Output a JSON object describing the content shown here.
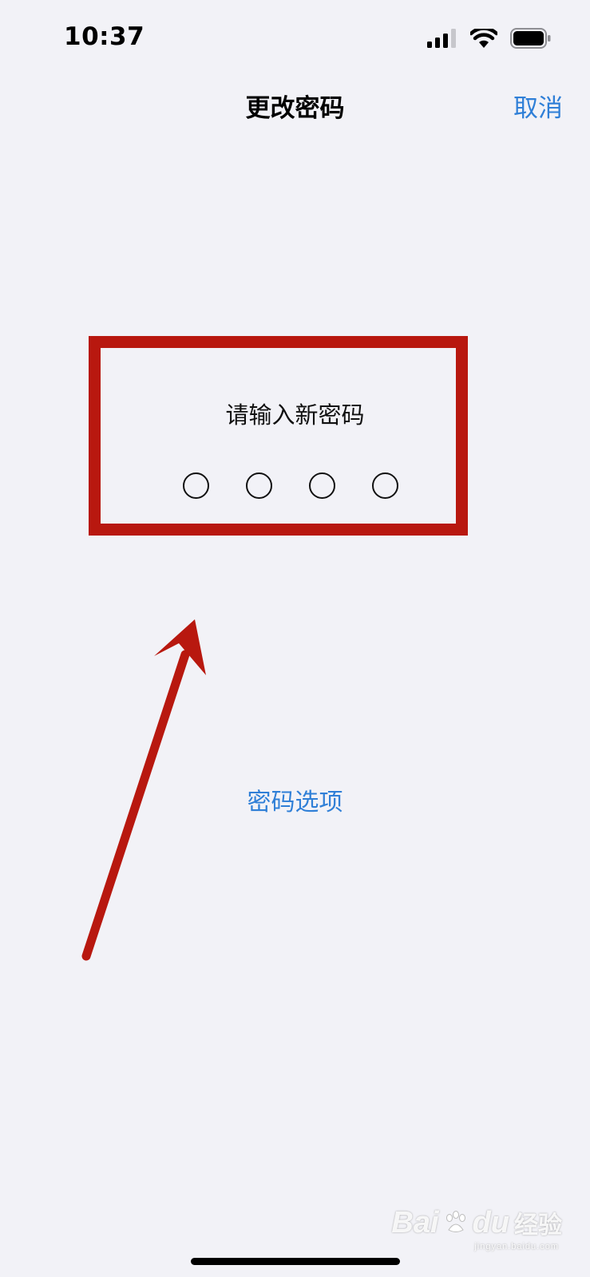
{
  "status_bar": {
    "time": "10:37",
    "icons": [
      "cellular-signal-icon",
      "wifi-icon",
      "battery-icon"
    ]
  },
  "nav": {
    "title": "更改密码",
    "cancel_label": "取消"
  },
  "passcode": {
    "prompt": "请输入新密码",
    "digit_count": 4
  },
  "options_link": "密码选项",
  "watermark": {
    "brand": "Bai",
    "brand_suffix": "du",
    "cn": "经验",
    "sub": "jingyan.baidu.com"
  },
  "colors": {
    "accent": "#2f7fd7",
    "annotation_red": "#b8180f",
    "background": "#f2f2f7"
  }
}
